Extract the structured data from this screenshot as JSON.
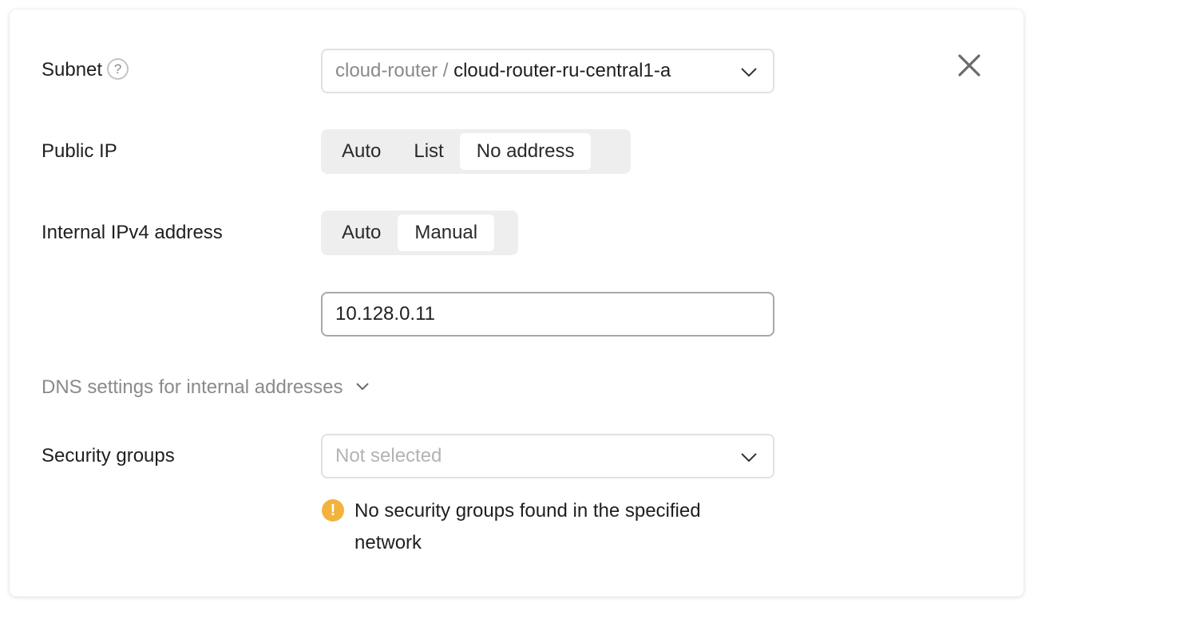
{
  "subnet": {
    "label": "Subnet",
    "help_glyph": "?",
    "value_prefix": "cloud-router / ",
    "value": "cloud-router-ru-central1-a"
  },
  "public_ip": {
    "label": "Public IP",
    "options": [
      "Auto",
      "List",
      "No address"
    ],
    "selected": "No address"
  },
  "internal_ipv4": {
    "label": "Internal IPv4 address",
    "options": [
      "Auto",
      "Manual"
    ],
    "selected": "Manual",
    "address": "10.128.0.11"
  },
  "dns": {
    "label": "DNS settings for internal addresses"
  },
  "security_groups": {
    "label": "Security groups",
    "placeholder": "Not selected",
    "warning_glyph": "!",
    "warning": "No security groups found in the specified network"
  },
  "icons": {
    "close": "close-icon",
    "chevron": "chevron-down-icon",
    "help": "help-icon",
    "warning": "warning-icon"
  },
  "colors": {
    "warning": "#f2b33d",
    "segment_bg": "#eeeeee",
    "muted_text": "#8a8a8a"
  }
}
